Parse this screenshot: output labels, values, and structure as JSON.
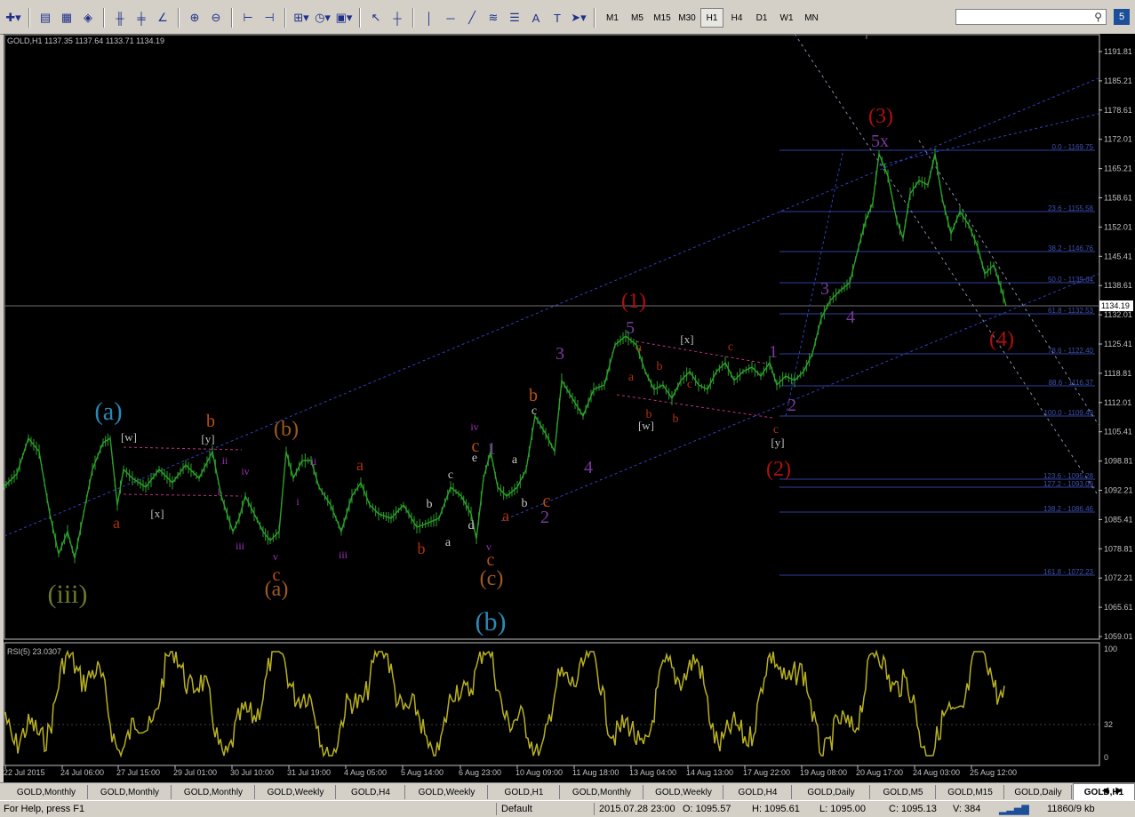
{
  "toolbar": {
    "timeframes": [
      "M1",
      "M5",
      "M15",
      "M30",
      "H1",
      "H4",
      "D1",
      "W1",
      "MN"
    ],
    "active_timeframe": "H1",
    "badge": "5"
  },
  "chart": {
    "header": "GOLD,H1  1137.35 1137.64 1133.71 1134.19",
    "price_axis": [
      "1191.81",
      "1185.21",
      "1178.61",
      "1172.01",
      "1165.21",
      "1158.61",
      "1152.01",
      "1145.41",
      "1138.61",
      "1132.01",
      "1125.41",
      "1118.81",
      "1112.01",
      "1105.41",
      "1098.81",
      "1092.21",
      "1085.41",
      "1078.81",
      "1072.21",
      "1065.61",
      "1059.01"
    ],
    "current_price": "1134.19",
    "time_axis": [
      "22 Jul 2015",
      "24 Jul 06:00",
      "27 Jul 15:00",
      "29 Jul 01:00",
      "30 Jul 10:00",
      "31 Jul 19:00",
      "4 Aug 05:00",
      "5 Aug 14:00",
      "6 Aug 23:00",
      "10 Aug 09:00",
      "11 Aug 18:00",
      "13 Aug 04:00",
      "14 Aug 13:00",
      "17 Aug 22:00",
      "19 Aug 08:00",
      "20 Aug 17:00",
      "24 Aug 03:00",
      "25 Aug 12:00"
    ],
    "fib_levels": [
      "0.0 - 1169.75",
      "23.6 - 1155.58",
      "38.2 - 1146.76",
      "50.0 - 1139.64",
      "61.8 - 1132.53",
      "78.6 - 1122.40",
      "88.6 - 1116.37",
      "100.0 - 1109.49",
      "123.6 - 1095.28",
      "127.2 - 1093.09",
      "138.2 - 1086.46",
      "161.8 - 1072.23"
    ],
    "wave_labels": [
      {
        "t": "(iii)",
        "color": "#6b7a2a",
        "size": 30
      },
      {
        "t": "(a)",
        "color": "#2a88b8",
        "size": 28
      },
      {
        "t": "a",
        "color": "#b03010",
        "size": 18
      },
      {
        "t": "[w]",
        "color": "#c0c0c0",
        "size": 13
      },
      {
        "t": "[x]",
        "color": "#c0c0c0",
        "size": 13
      },
      {
        "t": "[y]",
        "color": "#c0c0c0",
        "size": 13
      },
      {
        "t": "b",
        "color": "#c05010",
        "size": 20
      },
      {
        "t": "ii",
        "color": "#a030c0",
        "size": 12
      },
      {
        "t": "i",
        "color": "#a030c0",
        "size": 12
      },
      {
        "t": "iv",
        "color": "#a030c0",
        "size": 12
      },
      {
        "t": "iii",
        "color": "#a030c0",
        "size": 12
      },
      {
        "t": "v",
        "color": "#a030c0",
        "size": 12
      },
      {
        "t": "c",
        "color": "#c05010",
        "size": 20
      },
      {
        "t": "(a)",
        "color": "#a05a20",
        "size": 24
      },
      {
        "t": "(b)",
        "color": "#a05a20",
        "size": 24
      },
      {
        "t": "i",
        "color": "#a030c0",
        "size": 12
      },
      {
        "t": "ii",
        "color": "#a030c0",
        "size": 12
      },
      {
        "t": "iii",
        "color": "#a030c0",
        "size": 12
      },
      {
        "t": "a",
        "color": "#b03010",
        "size": 18
      },
      {
        "t": "b",
        "color": "#b03010",
        "size": 18
      },
      {
        "t": "a",
        "color": "#c8c8c8",
        "size": 14
      },
      {
        "t": "b",
        "color": "#c8c8c8",
        "size": 14
      },
      {
        "t": "c",
        "color": "#c8c8c8",
        "size": 14
      },
      {
        "t": "d",
        "color": "#c8c8c8",
        "size": 14
      },
      {
        "t": "e",
        "color": "#c8c8c8",
        "size": 14
      },
      {
        "t": "iv",
        "color": "#a030c0",
        "size": 12
      },
      {
        "t": "c",
        "color": "#c05010",
        "size": 20
      },
      {
        "t": "v",
        "color": "#a030c0",
        "size": 12
      },
      {
        "t": "c",
        "color": "#c05010",
        "size": 20
      },
      {
        "t": "(c)",
        "color": "#a05a20",
        "size": 24
      },
      {
        "t": "(b)",
        "color": "#2a88b8",
        "size": 30
      },
      {
        "t": "1",
        "color": "#7a3aa0",
        "size": 20
      },
      {
        "t": "a",
        "color": "#c8c8c8",
        "size": 14
      },
      {
        "t": "b",
        "color": "#c8c8c8",
        "size": 14
      },
      {
        "t": "c",
        "color": "#c8c8c8",
        "size": 14
      },
      {
        "t": "a",
        "color": "#b03010",
        "size": 18
      },
      {
        "t": "b",
        "color": "#c05010",
        "size": 20
      },
      {
        "t": "c",
        "color": "#c05010",
        "size": 20
      },
      {
        "t": "2",
        "color": "#7a3aa0",
        "size": 20
      },
      {
        "t": "3",
        "color": "#7a3aa0",
        "size": 20
      },
      {
        "t": "4",
        "color": "#7a3aa0",
        "size": 20
      },
      {
        "t": "5",
        "color": "#7a3aa0",
        "size": 20
      },
      {
        "t": "(1)",
        "color": "#b01010",
        "size": 24
      },
      {
        "t": "a",
        "color": "#b03010",
        "size": 14
      },
      {
        "t": "b",
        "color": "#b03010",
        "size": 14
      },
      {
        "t": "c",
        "color": "#b03010",
        "size": 14
      },
      {
        "t": "[w]",
        "color": "#c0c0c0",
        "size": 13
      },
      {
        "t": "[x]",
        "color": "#c0c0c0",
        "size": 13
      },
      {
        "t": "a",
        "color": "#b03010",
        "size": 14
      },
      {
        "t": "b",
        "color": "#b03010",
        "size": 14
      },
      {
        "t": "c",
        "color": "#b03010",
        "size": 14
      },
      {
        "t": "b",
        "color": "#b03010",
        "size": 14
      },
      {
        "t": "1",
        "color": "#7a3aa0",
        "size": 20
      },
      {
        "t": "c",
        "color": "#b03010",
        "size": 14
      },
      {
        "t": "[y]",
        "color": "#c0c0c0",
        "size": 13
      },
      {
        "t": "(2)",
        "color": "#b01010",
        "size": 24
      },
      {
        "t": "2",
        "color": "#7a3aa0",
        "size": 20
      },
      {
        "t": "3",
        "color": "#7a3aa0",
        "size": 20
      },
      {
        "t": "4",
        "color": "#7a3aa0",
        "size": 20
      },
      {
        "t": "5x",
        "color": "#7a3aa0",
        "size": 20
      },
      {
        "t": "(3)",
        "color": "#b01010",
        "size": 24
      },
      {
        "t": "(4)",
        "color": "#b01010",
        "size": 24
      }
    ]
  },
  "rsi": {
    "header": "RSI(5) 23.0307",
    "levels": [
      "100",
      "32",
      "0"
    ]
  },
  "tabs": [
    "GOLD,Monthly",
    "GOLD,Monthly",
    "GOLD,Monthly",
    "GOLD,Weekly",
    "GOLD,H4",
    "GOLD,Weekly",
    "GOLD,H1",
    "GOLD,Monthly",
    "GOLD,Weekly",
    "GOLD,H4",
    "GOLD,Daily",
    "GOLD,M5",
    "GOLD,M15",
    "GOLD,Daily",
    "GOLD,H1"
  ],
  "active_tab": "GOLD,H1",
  "status": {
    "help": "For Help, press F1",
    "profile": "Default",
    "datetime": "2015.07.28 23:00",
    "open": "O: 1095.57",
    "high": "H: 1095.61",
    "low": "L: 1095.00",
    "close": "C: 1095.13",
    "volume": "V: 384",
    "traffic": "11860/9 kb"
  },
  "colors": {
    "candles": "#2aa02a",
    "rsi_line": "#b8b020",
    "fib_lines": "#3040a0",
    "channel": "#3040c0"
  }
}
